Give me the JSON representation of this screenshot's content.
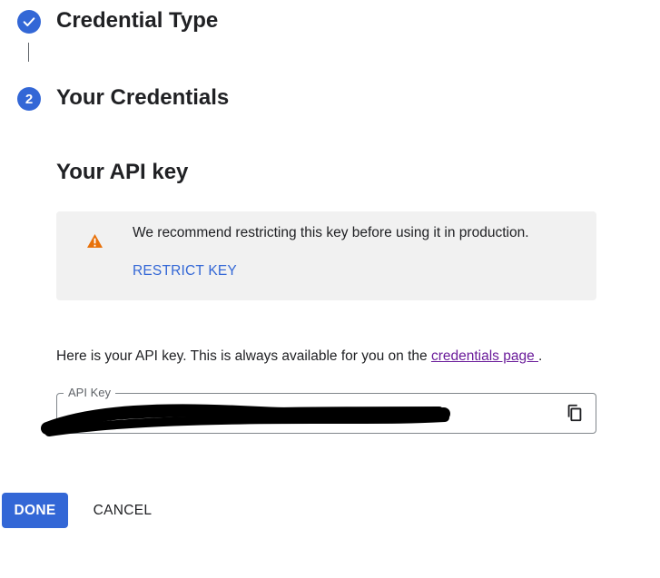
{
  "steps": [
    {
      "title": "Credential Type",
      "status": "completed",
      "icon": "check-icon"
    },
    {
      "number": "2",
      "title": "Your Credentials",
      "status": "active"
    }
  ],
  "section": {
    "title": "Your API key"
  },
  "warning": {
    "icon": "warning-icon",
    "icon_color": "#e8710a",
    "message": "We recommend restricting this key before using it in production.",
    "action_label": "RESTRICT KEY"
  },
  "info": {
    "prefix": "Here is your API key. This is always available for you on the ",
    "link_text": "credentials page ",
    "suffix": "."
  },
  "key_field": {
    "label": "API Key",
    "value": "",
    "copy_icon": "copy-icon",
    "redacted": true
  },
  "actions": {
    "done_label": "DONE",
    "cancel_label": "CANCEL"
  },
  "colors": {
    "accent": "#3367d6",
    "link_visited": "#6a1b9a",
    "warning_bg": "#f1f1f1"
  }
}
